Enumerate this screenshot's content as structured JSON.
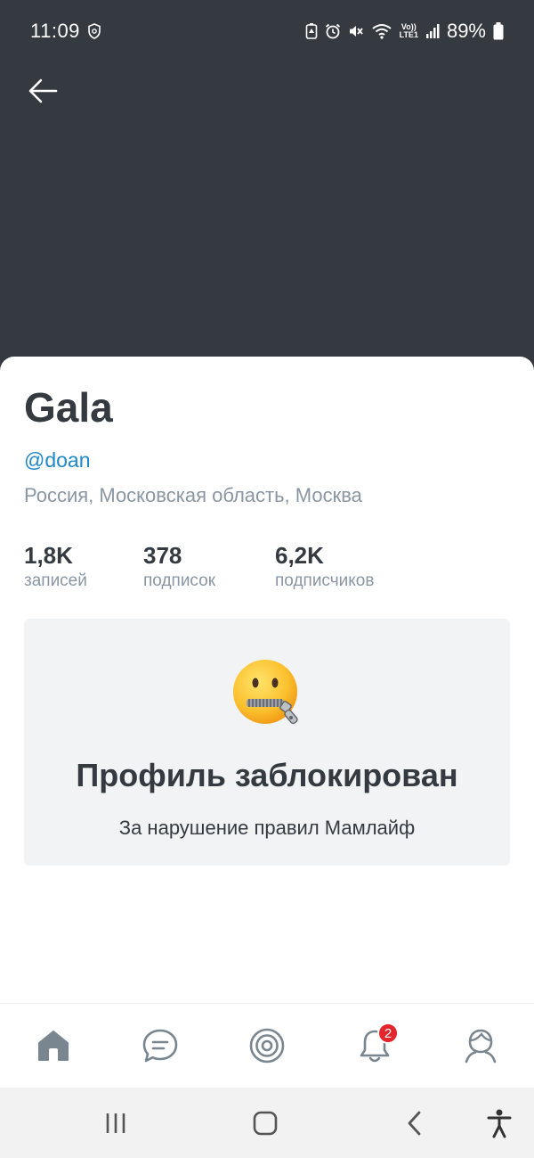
{
  "status_bar": {
    "time": "11:09",
    "battery": "89%",
    "network": "LTE1",
    "volte": "Vo))"
  },
  "colors": {
    "header_bg": "#343a40",
    "accent": "#1e88c8",
    "muted": "#8a96a3",
    "badge": "#e3262c"
  },
  "profile": {
    "name": "Gala",
    "handle": "@doan",
    "location": "Россия, Московская область, Москва"
  },
  "stats": [
    {
      "value": "1,8K",
      "label": "записей"
    },
    {
      "value": "378",
      "label": "подписок"
    },
    {
      "value": "6,2K",
      "label": "подписчиков"
    }
  ],
  "blocked": {
    "emoji": "zipper-mouth-face",
    "title": "Профиль заблокирован",
    "reason": "За нарушение правил Мамлайф"
  },
  "bottom_nav": {
    "items": [
      {
        "icon": "home-icon",
        "active": true
      },
      {
        "icon": "chat-icon"
      },
      {
        "icon": "target-icon"
      },
      {
        "icon": "bell-icon",
        "badge": "2"
      },
      {
        "icon": "profile-icon"
      }
    ]
  },
  "system_nav": [
    "recent-apps",
    "home",
    "back",
    "accessibility"
  ]
}
